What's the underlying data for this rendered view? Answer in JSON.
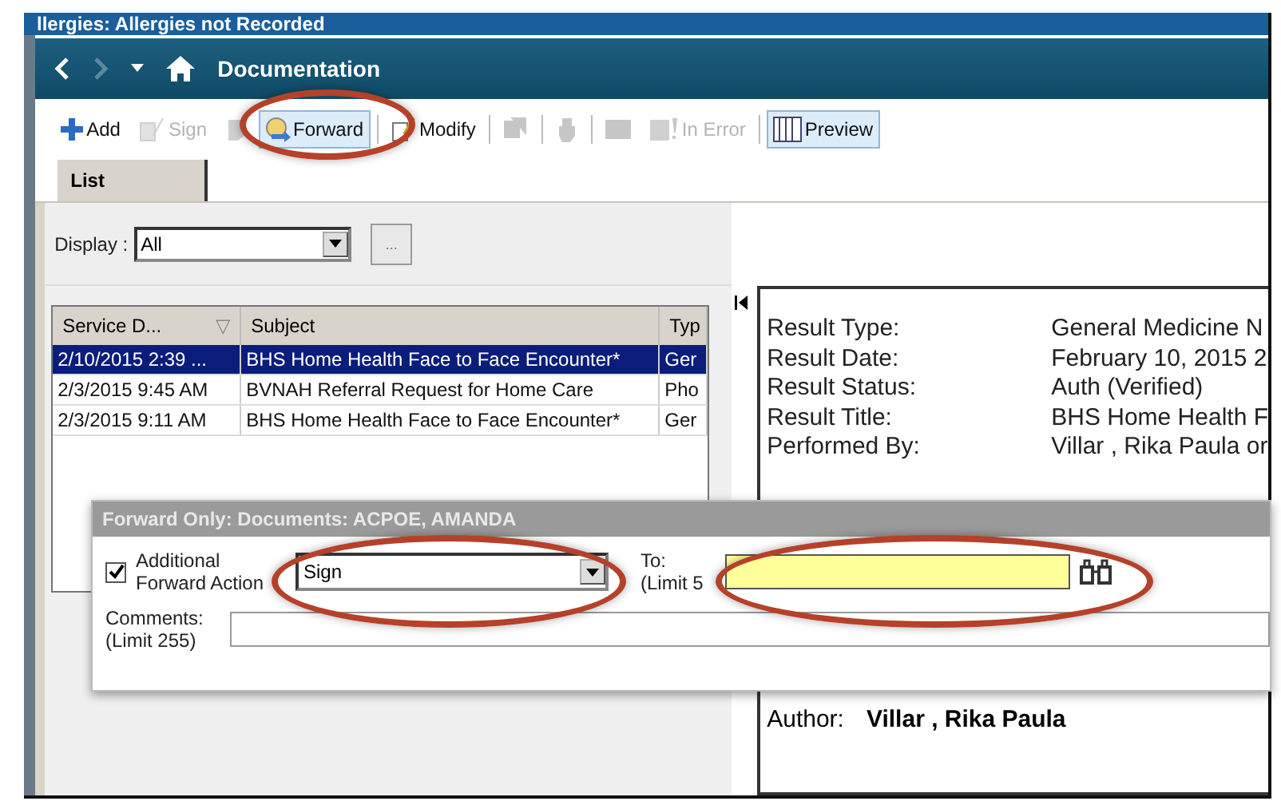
{
  "window": {
    "title": "llergies: Allergies not Recorded"
  },
  "nav": {
    "title": "Documentation"
  },
  "toolbar": [
    {
      "kind": "add",
      "label": "Add",
      "disabled": false,
      "selected": false
    },
    {
      "kind": "sign",
      "label": "Sign",
      "disabled": true,
      "selected": false
    },
    {
      "kind": "note",
      "disabled": true,
      "selected": false
    },
    {
      "kind": "forward",
      "label": "Forward",
      "disabled": false,
      "selected": true
    },
    {
      "kind": "separator"
    },
    {
      "kind": "modify",
      "label": "Modify",
      "disabled": false,
      "selected": false
    },
    {
      "kind": "separator"
    },
    {
      "kind": "copy",
      "disabled": true,
      "selected": false
    },
    {
      "kind": "separator"
    },
    {
      "kind": "hand",
      "disabled": true,
      "selected": false
    },
    {
      "kind": "separator"
    },
    {
      "kind": "block",
      "disabled": true,
      "selected": false
    },
    {
      "kind": "error",
      "label": "In Error",
      "disabled": true,
      "selected": false
    },
    {
      "kind": "separator"
    },
    {
      "kind": "preview",
      "label": "Preview",
      "disabled": false,
      "selected": true
    }
  ],
  "tabs": [
    {
      "label": "List",
      "selected": true
    }
  ],
  "display": {
    "label": "Display :",
    "value": "All",
    "more": "..."
  },
  "table": {
    "columns": [
      {
        "label": "Service D...",
        "sort": "▽"
      },
      {
        "label": "Subject"
      },
      {
        "label": "Typ"
      }
    ],
    "rows": [
      {
        "selected": true,
        "cells": [
          "2/10/2015 2:39 ...",
          "BHS Home Health Face to Face Encounter*",
          "Ger"
        ]
      },
      {
        "selected": false,
        "cells": [
          "2/3/2015 9:45 AM",
          "BVNAH Referral Request for Home Care",
          "Pho"
        ]
      },
      {
        "selected": false,
        "cells": [
          "2/3/2015 9:11 AM",
          "BHS Home Health Face to Face Encounter*",
          "Ger"
        ]
      }
    ]
  },
  "preview": {
    "fields": [
      {
        "label": "Result Type:",
        "value": "General Medicine N"
      },
      {
        "label": "Result Date:",
        "value": "February 10, 2015 2"
      },
      {
        "label": "Result Status:",
        "value": "Auth (Verified)"
      },
      {
        "label": "Result Title:",
        "value": "BHS Home Health F"
      },
      {
        "label": "Performed By:",
        "value": "Villar , Rika Paula or"
      }
    ],
    "author": {
      "label": "Author:",
      "value": "Villar , Rika Paula"
    }
  },
  "dialog": {
    "title": "Forward Only: Documents: ACPOE, AMANDA",
    "checkbox": {
      "label": "Additional Forward Action",
      "checked": true
    },
    "action": {
      "value": "Sign"
    },
    "to": {
      "label": "To:",
      "limit": "(Limit 5"
    },
    "comments": {
      "label": "Comments:",
      "limit": "(Limit 255)"
    }
  }
}
